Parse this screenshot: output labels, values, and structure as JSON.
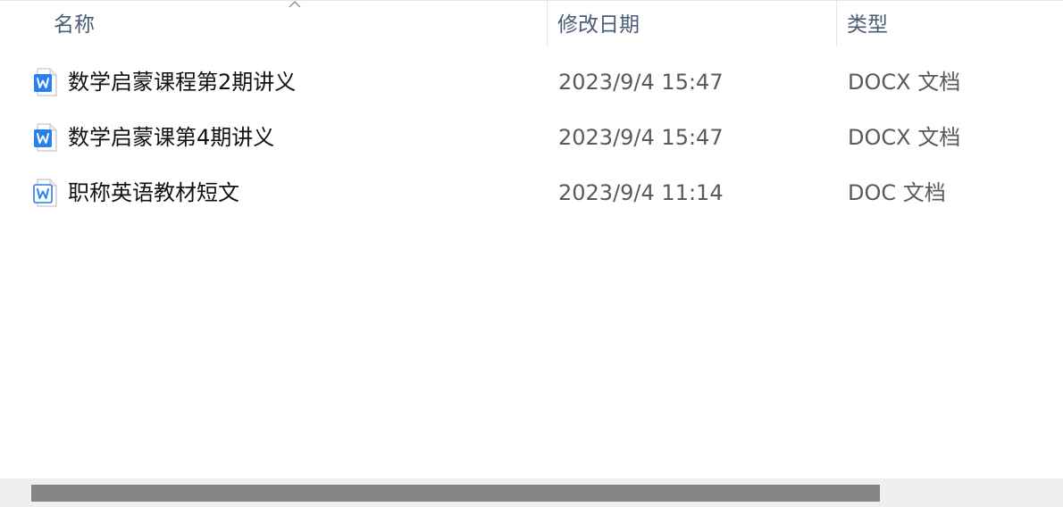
{
  "columns": {
    "name": "名称",
    "date": "修改日期",
    "type": "类型"
  },
  "sort": {
    "column": "name",
    "icon": "chevron-up-icon"
  },
  "files": [
    {
      "name": "数学启蒙课程第2期讲义",
      "date": "2023/9/4 15:47",
      "type": "DOCX 文档",
      "icon": "wps-docx-icon"
    },
    {
      "name": "数学启蒙课第4期讲义",
      "date": "2023/9/4 15:47",
      "type": "DOCX 文档",
      "icon": "wps-docx-icon"
    },
    {
      "name": "职称英语教材短文",
      "date": "2023/9/4 11:14",
      "type": "DOC 文档",
      "icon": "wps-doc-icon"
    }
  ],
  "colors": {
    "header_text": "#4a5d75",
    "name_text": "#111111",
    "meta_text": "#5a5a5a",
    "wps_blue": "#2a7ff0",
    "scroll_track": "#efefef",
    "scroll_thumb": "#858585"
  }
}
